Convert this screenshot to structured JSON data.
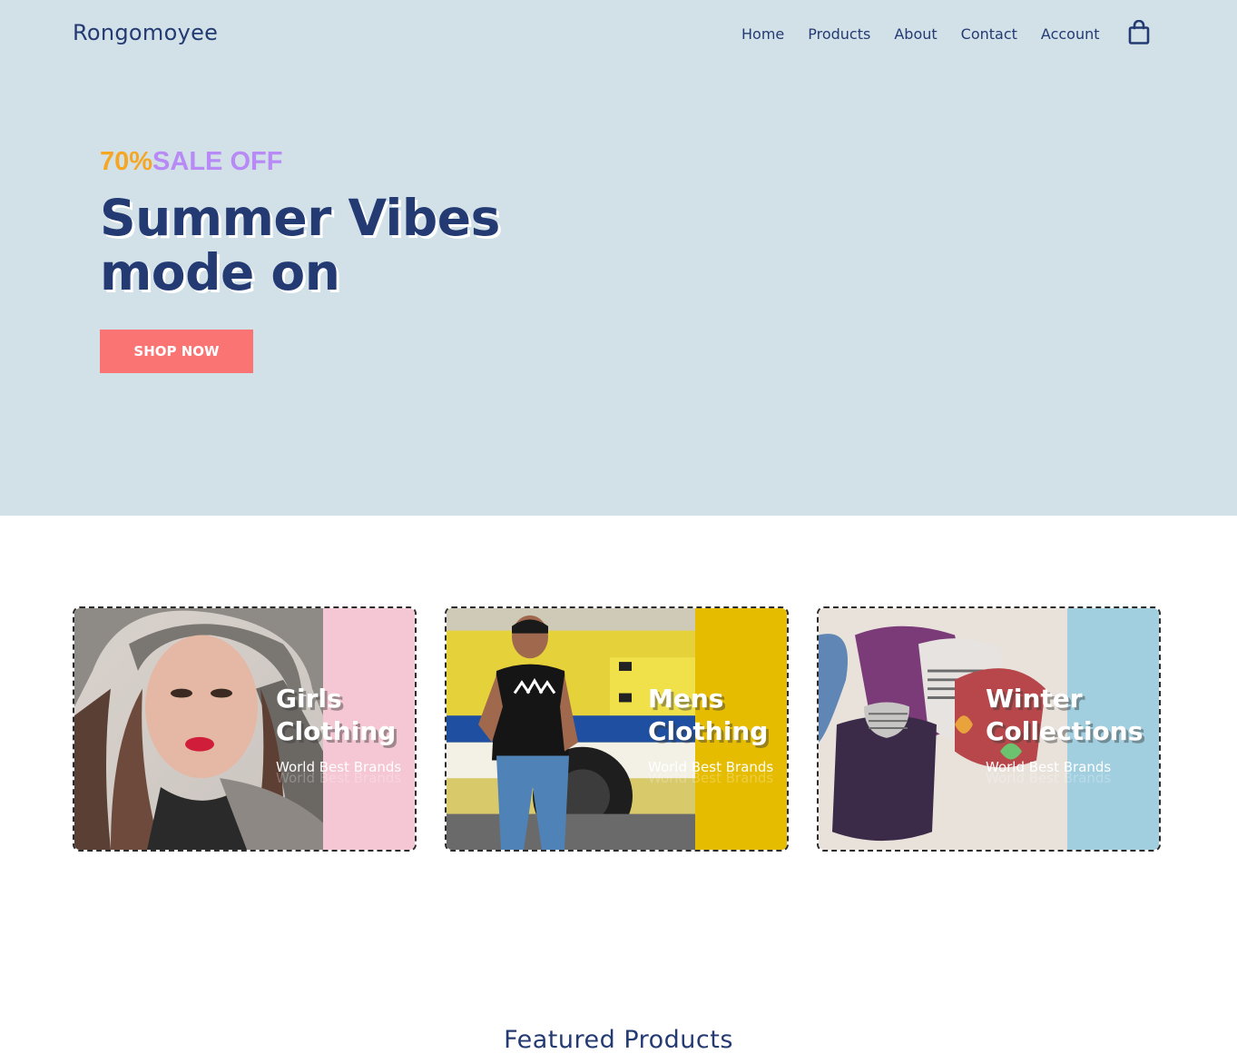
{
  "header": {
    "logo": "Rongomoyee",
    "nav": [
      "Home",
      "Products",
      "About",
      "Contact",
      "Account"
    ],
    "cart_icon": "shopping-bag-icon"
  },
  "hero": {
    "promo_percent": "70%",
    "promo_text": "SALE OFF",
    "headline_line1": "Summer Vibes",
    "headline_line2": "mode on",
    "cta": "SHOP NOW",
    "colors": {
      "background": "#d2e1e8",
      "accent_percent": "#f5a623",
      "accent_sale": "#b78af5",
      "button": "#fb7474",
      "text": "#243a73"
    }
  },
  "categories": [
    {
      "title_line1": "Girls",
      "title_line2": "Clothing",
      "subtitle": "World Best Brands",
      "band_color": "#f5c6d3"
    },
    {
      "title_line1": "Mens",
      "title_line2": "Clothing",
      "subtitle": "World Best Brands",
      "band_color": "#e6bc00"
    },
    {
      "title_line1": "Winter",
      "title_line2": "Collections",
      "subtitle": "World Best Brands",
      "band_color": "#a1cfe0"
    }
  ],
  "featured": {
    "heading": "Featured Products"
  }
}
